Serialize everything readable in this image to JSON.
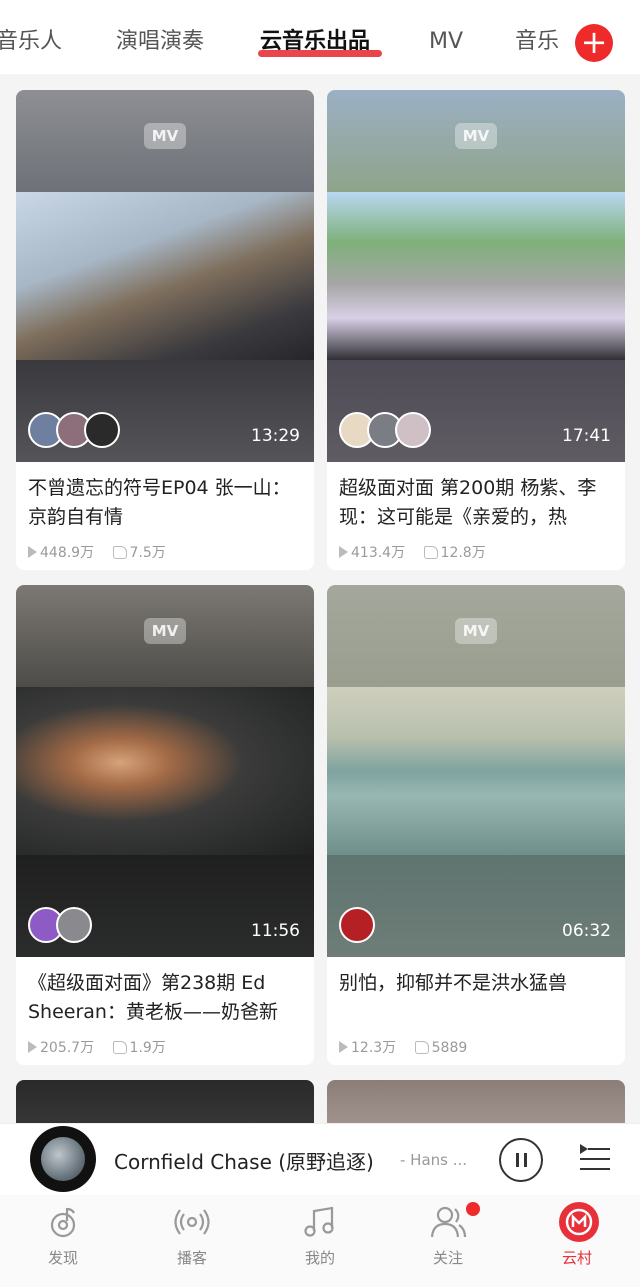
{
  "tabs": {
    "items": [
      {
        "label": "音乐人"
      },
      {
        "label": "演唱演奏"
      },
      {
        "label": "云音乐出品"
      },
      {
        "label": "MV"
      },
      {
        "label": "音乐"
      }
    ],
    "active": "云音乐出品",
    "add_label": "+"
  },
  "videos": [
    {
      "badge": "MV",
      "duration": "13:29",
      "title": "不曾遗忘的符号EP04 张一山：京韵自有情",
      "plays": "448.9万",
      "likes": "7.5万"
    },
    {
      "badge": "MV",
      "duration": "17:41",
      "title": "超级面对面 第200期  杨紫、李现：这可能是《亲爱的，热",
      "plays": "413.4万",
      "likes": "12.8万"
    },
    {
      "badge": "MV",
      "duration": "11:56",
      "title": "《超级面对面》第238期  Ed Sheeran：黄老板——奶爸新",
      "plays": "205.7万",
      "likes": "1.9万"
    },
    {
      "badge": "MV",
      "duration": "06:32",
      "title": "别怕，抑郁并不是洪水猛兽",
      "plays": "12.3万",
      "likes": "5889"
    }
  ],
  "player": {
    "song": "Cornfield Chase (原野追逐)",
    "artist": "- Hans ...",
    "state": "playing"
  },
  "nav": {
    "items": [
      {
        "label": "发现",
        "icon": "discover-icon"
      },
      {
        "label": "播客",
        "icon": "podcast-icon"
      },
      {
        "label": "我的",
        "icon": "music-note-icon"
      },
      {
        "label": "关注",
        "icon": "follow-icon"
      },
      {
        "label": "云村",
        "icon": "cloud-village-icon"
      }
    ],
    "active": "云村"
  },
  "colors": {
    "accent": "#e8303a"
  }
}
